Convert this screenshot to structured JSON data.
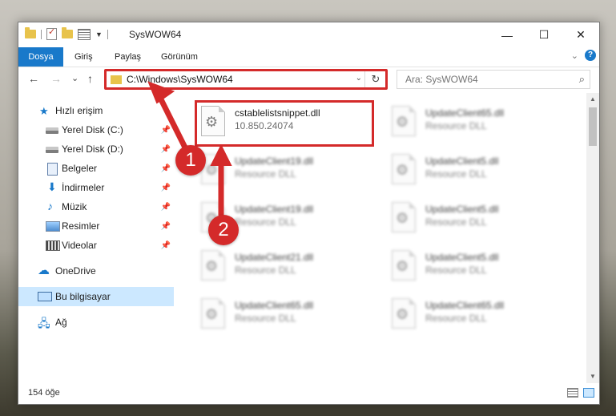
{
  "window": {
    "title": "SysWOW64",
    "controls": {
      "minimize": "—",
      "maximize": "☐",
      "close": "✕"
    }
  },
  "ribbon": {
    "tabs": [
      "Dosya",
      "Giriş",
      "Paylaş",
      "Görünüm"
    ],
    "help": "?"
  },
  "nav": {
    "back": "←",
    "forward": "→",
    "recent": "⌄",
    "up": "↑",
    "address": "C:\\Windows\\SysWOW64",
    "refresh": "↻",
    "search_placeholder": "Ara: SysWOW64"
  },
  "sidebar": {
    "items": [
      {
        "label": "Hızlı erişim",
        "icon": "star-icon",
        "pinned": false
      },
      {
        "label": "Yerel Disk (C:)",
        "icon": "disk-icon",
        "pinned": true
      },
      {
        "label": "Yerel Disk (D:)",
        "icon": "disk-icon",
        "pinned": true
      },
      {
        "label": "Belgeler",
        "icon": "documents-icon",
        "pinned": true
      },
      {
        "label": "İndirmeler",
        "icon": "download-icon",
        "pinned": true
      },
      {
        "label": "Müzik",
        "icon": "music-icon",
        "pinned": true
      },
      {
        "label": "Resimler",
        "icon": "pictures-icon",
        "pinned": true
      },
      {
        "label": "Videolar",
        "icon": "videos-icon",
        "pinned": true
      },
      {
        "label": "OneDrive",
        "icon": "cloud-icon",
        "pinned": false
      },
      {
        "label": "Bu bilgisayar",
        "icon": "computer-icon",
        "pinned": false,
        "selected": true
      },
      {
        "label": "Ağ",
        "icon": "network-icon",
        "pinned": false
      }
    ]
  },
  "files": [
    {
      "name": "cstablelistsnippet.dll",
      "sub": "10.850.24074",
      "highlighted": true
    },
    {
      "name": "UpdateClient65.dll",
      "sub": "Resource DLL"
    },
    {
      "name": "UpdateClient19.dll",
      "sub": "Resource DLL"
    },
    {
      "name": "UpdateClient5.dll",
      "sub": "Resource DLL"
    },
    {
      "name": "UpdateClient19.dll",
      "sub": "Resource DLL"
    },
    {
      "name": "UpdateClient5.dll",
      "sub": "Resource DLL"
    },
    {
      "name": "UpdateClient21.dll",
      "sub": "Resource DLL"
    },
    {
      "name": "UpdateClient5.dll",
      "sub": "Resource DLL"
    },
    {
      "name": "UpdateClient65.dll",
      "sub": "Resource DLL"
    },
    {
      "name": "UpdateClient65.dll",
      "sub": "Resource DLL"
    }
  ],
  "status": {
    "count": "154 öğe"
  },
  "annotations": {
    "step1": "1",
    "step2": "2",
    "color": "#d42a2a"
  }
}
